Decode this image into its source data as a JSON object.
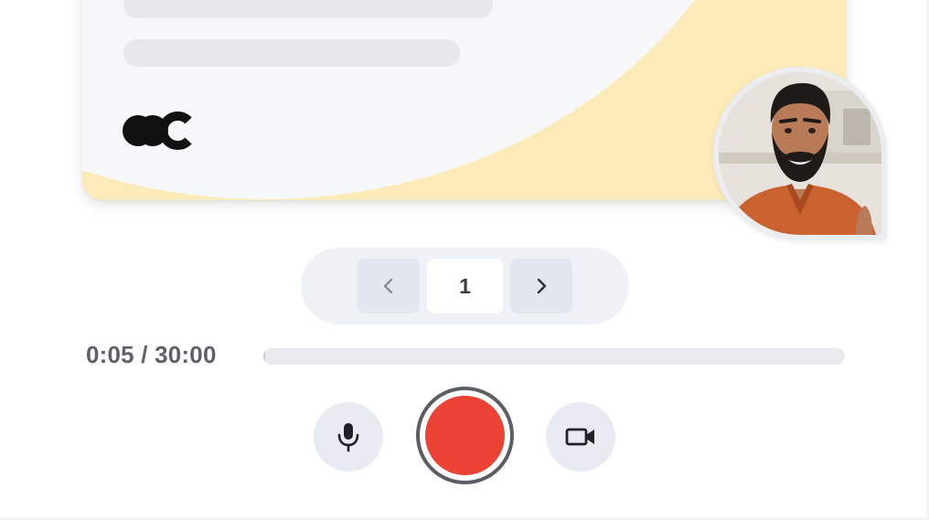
{
  "slide": {
    "colors": {
      "card_background": "#F6F7F9",
      "accent_shape": "#FCEBB8",
      "placeholder_lines": "#E7E8EB",
      "logo": "#111111"
    },
    "logo_icon": "brand-logo"
  },
  "presenter": {
    "icon": "presenter-video-thumbnail"
  },
  "pager": {
    "current_page": "1",
    "prev_icon": "chevron-left-icon",
    "next_icon": "chevron-right-icon"
  },
  "recording": {
    "timer": "0:05 / 30:00",
    "progress_fraction": 0.0028
  },
  "controls": {
    "mic_icon": "microphone-icon",
    "record_icon": "record-icon",
    "camera_icon": "video-camera-icon",
    "record_color": "#EA4335"
  }
}
